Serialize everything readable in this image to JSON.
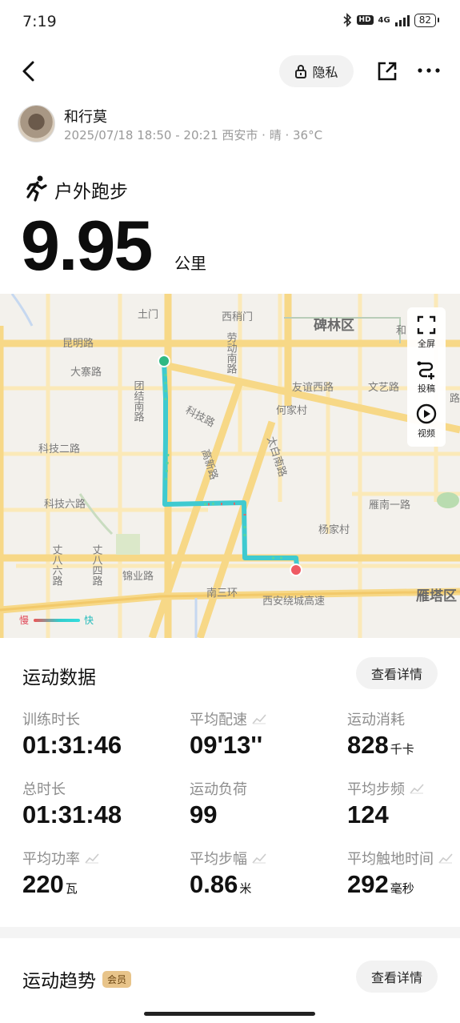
{
  "status_bar": {
    "time": "7:19",
    "network": "4G",
    "battery": "82"
  },
  "header": {
    "privacy_label": "隐私"
  },
  "user": {
    "name": "和行莫",
    "meta": "2025/07/18 18:50 - 20:21 西安市 · 晴 · 36°C"
  },
  "activity": {
    "type": "户外跑步",
    "distance": "9.95",
    "distance_unit": "公里"
  },
  "map": {
    "tools": {
      "fullscreen": "全屏",
      "post": "投稿",
      "video": "视频"
    },
    "legend": {
      "slow": "慢",
      "fast": "快"
    },
    "labels": [
      "土门",
      "西稍门",
      "碑林区",
      "和",
      "昆明路",
      "大寨路",
      "团结南路",
      "劳动南路",
      "友谊西路",
      "文艺路",
      "路",
      "科技路",
      "何家村",
      "太白南路",
      "高新路",
      "科技二路",
      "科技六路",
      "雁南一路",
      "杨家村",
      "丈八六路",
      "丈八四路",
      "锦业路",
      "南三环",
      "西安绕城高速",
      "雁塔区"
    ]
  },
  "stats_card": {
    "title": "运动数据",
    "detail_button": "查看详情",
    "items": [
      {
        "label": "训练时长",
        "value": "01:31:46",
        "unit": ""
      },
      {
        "label": "平均配速",
        "value": "09'13''",
        "unit": ""
      },
      {
        "label": "运动消耗",
        "value": "828",
        "unit": "千卡"
      },
      {
        "label": "总时长",
        "value": "01:31:48",
        "unit": ""
      },
      {
        "label": "运动负荷",
        "value": "99",
        "unit": ""
      },
      {
        "label": "平均步频",
        "value": "124",
        "unit": ""
      },
      {
        "label": "平均功率",
        "value": "220",
        "unit": "瓦"
      },
      {
        "label": "平均步幅",
        "value": "0.86",
        "unit": "米"
      },
      {
        "label": "平均触地时间",
        "value": "292",
        "unit": "毫秒"
      }
    ]
  },
  "trend_card": {
    "title": "运动趋势",
    "badge": "会员",
    "detail_button": "查看详情"
  }
}
